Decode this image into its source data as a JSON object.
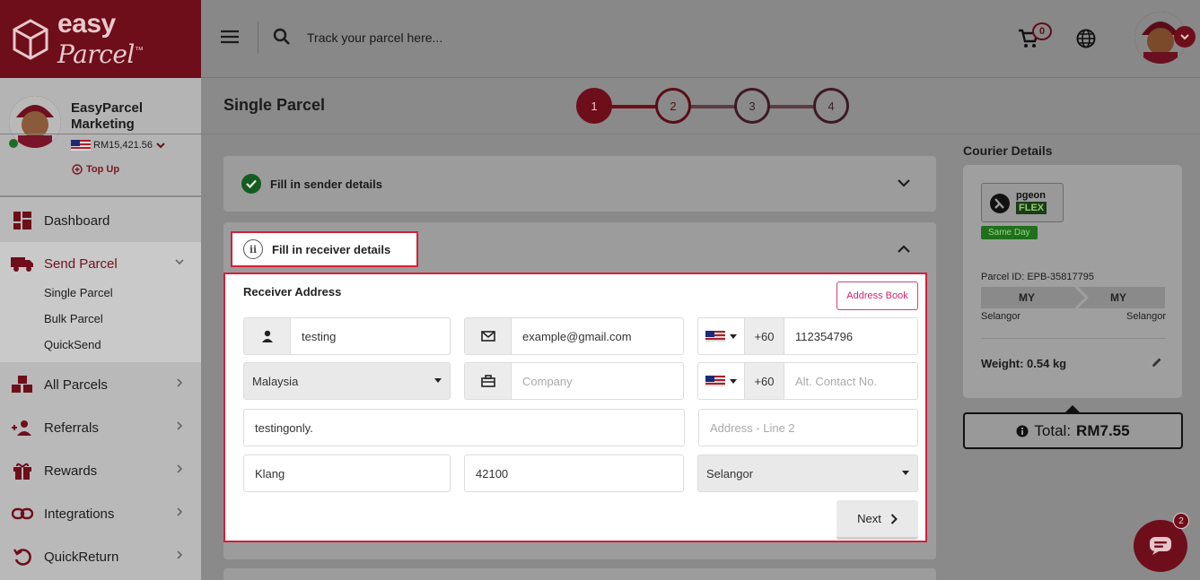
{
  "brand": {
    "name": "easy",
    "name_script": "Parcel",
    "tm": "™"
  },
  "topbar": {
    "search_placeholder": "Track your parcel here...",
    "cart_count": "0"
  },
  "profile": {
    "name": "EasyParcel Marketing",
    "balance": "RM15,421.56",
    "topup_label": "Top Up"
  },
  "sidebar": {
    "items": [
      {
        "label": "Dashboard",
        "icon": "dashboard-icon"
      },
      {
        "label": "Send Parcel",
        "icon": "truck-icon"
      },
      {
        "label": "All Parcels",
        "icon": "boxes-icon"
      },
      {
        "label": "Referrals",
        "icon": "users-add-icon"
      },
      {
        "label": "Rewards",
        "icon": "gift-icon"
      },
      {
        "label": "Integrations",
        "icon": "link-icon"
      },
      {
        "label": "QuickReturn",
        "icon": "return-icon"
      }
    ],
    "sub_items": [
      "Single Parcel",
      "Bulk Parcel",
      "QuickSend"
    ]
  },
  "page": {
    "title": "Single Parcel"
  },
  "stepper": {
    "steps": [
      "1",
      "2",
      "3",
      "4"
    ],
    "current": 2
  },
  "sections": {
    "sender_title": "Fill in sender details",
    "receiver_title": "Fill in receiver details"
  },
  "form": {
    "heading": "Receiver Address",
    "address_book_label": "Address Book",
    "name_value": "testing",
    "email_value": "example@gmail.com",
    "phone_code": "+60",
    "phone_value": "112354796",
    "country_value": "Malaysia",
    "company_placeholder": "Company",
    "alt_phone_code": "+60",
    "alt_phone_placeholder": "Alt. Contact No.",
    "address1_value": "testingonly.",
    "address2_placeholder": "Address - Line 2",
    "city_value": "Klang",
    "postcode_value": "42100",
    "state_value": "Selangor",
    "next_label": "Next"
  },
  "courier": {
    "title": "Courier Details",
    "logo_text": "pgeon",
    "logo_flex": "FLEX",
    "badge": "Same Day",
    "parcel_id": "Parcel ID: EPB-35817795",
    "from_country": "MY",
    "to_country": "MY",
    "from_state": "Selangor",
    "to_state": "Selangor",
    "weight": "Weight: 0.54 kg"
  },
  "total": {
    "label": "Total:",
    "amount": "RM7.55"
  },
  "chat": {
    "badge": "2"
  },
  "colors": {
    "brand": "#d41f3b",
    "dark_brand": "#6e0e1a",
    "success": "#155c1f"
  }
}
